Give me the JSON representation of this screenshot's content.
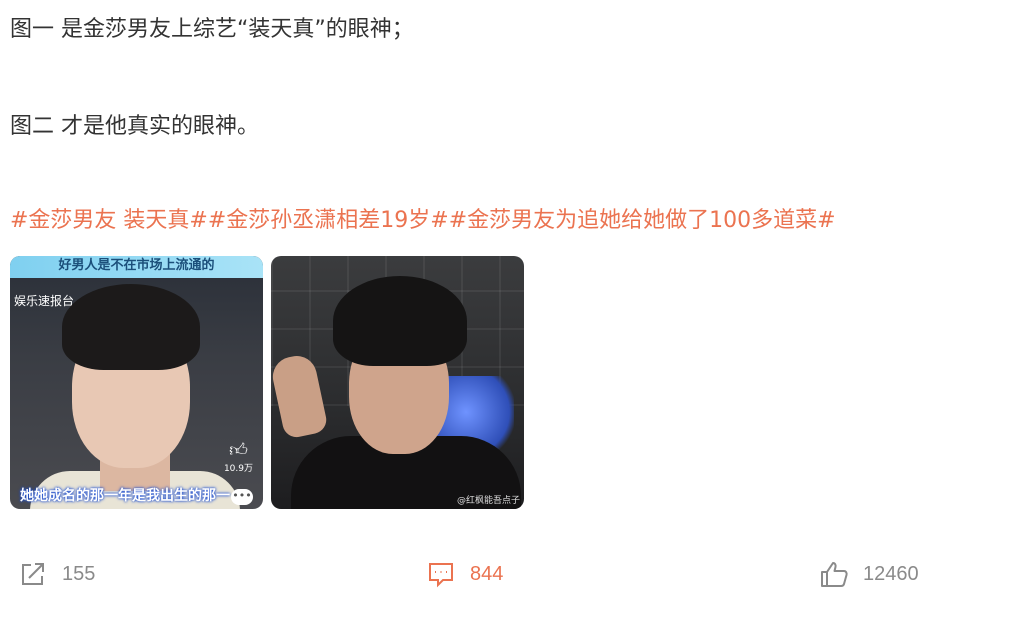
{
  "post": {
    "line1": "图一 是金莎男友上综艺“装天真”的眼神；",
    "line2": "图二 才是他真实的眼神。",
    "hashtags": [
      "#金莎男友 装天真#",
      "#金莎孙丞潇相差19岁#",
      "#金莎男友为追她给她做了100多道菜#"
    ]
  },
  "images": [
    {
      "banner": "好男人是不在市场上流通的",
      "source": "娱乐速报台",
      "like_count": "10.9万",
      "subtitle": "她她成名的那一年是我出生的那一"
    },
    {
      "watermark": "@红枫能吾点子"
    }
  ],
  "actions": {
    "share_count": "155",
    "comment_count": "844",
    "like_count": "12460"
  },
  "colors": {
    "accent": "#eb7350",
    "text": "#333333",
    "muted": "#8a8a8a"
  },
  "icons": {
    "share": "share-icon",
    "comment": "comment-icon",
    "like": "thumbs-up-icon"
  }
}
